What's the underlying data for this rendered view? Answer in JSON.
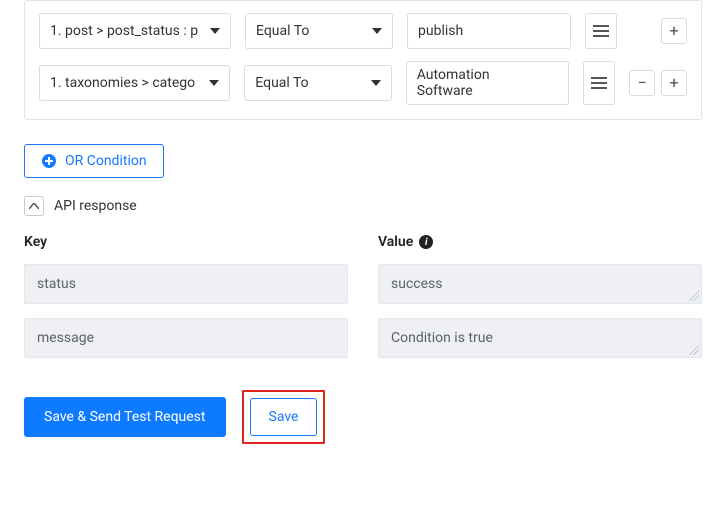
{
  "conditions": {
    "rows": [
      {
        "field": "1. post > post_status : p",
        "operator": "Equal To",
        "value_lines": [
          "publish"
        ],
        "show_remove": false
      },
      {
        "field": "1. taxonomies > catego",
        "operator": "Equal To",
        "value_lines": [
          "Automation",
          "Software"
        ],
        "show_remove": true
      }
    ]
  },
  "or_button": "OR Condition",
  "api_response_label": "API response",
  "kv": {
    "headers": {
      "key": "Key",
      "value": "Value"
    },
    "rows": [
      {
        "key": "status",
        "value": "success"
      },
      {
        "key": "message",
        "value": "Condition is true"
      }
    ]
  },
  "footer": {
    "save_send": "Save & Send Test Request",
    "save": "Save"
  },
  "glyphs": {
    "plus": "+",
    "minus": "−",
    "info": "i"
  }
}
